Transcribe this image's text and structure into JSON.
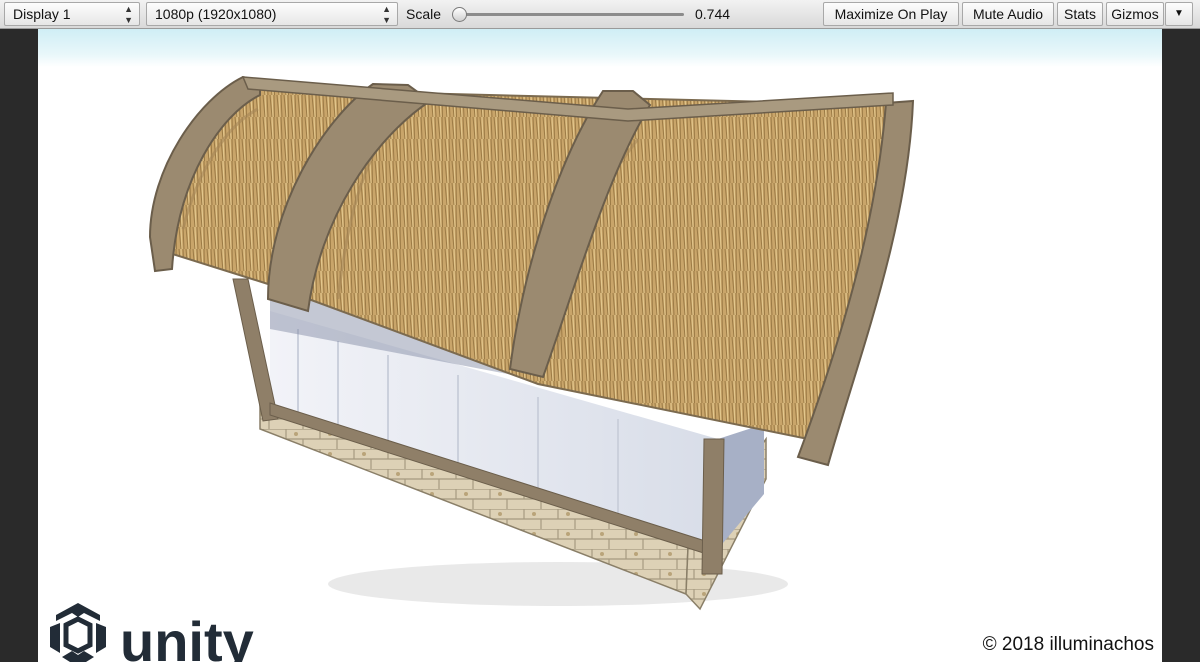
{
  "toolbar": {
    "display": "Display 1",
    "resolution": "1080p (1920x1080)",
    "scale_label": "Scale",
    "scale_value": "0.744",
    "scale_fraction": 0.0,
    "maximize_on_play": "Maximize On Play",
    "mute_audio": "Mute Audio",
    "stats": "Stats",
    "gizmos": "Gizmos"
  },
  "viewport": {
    "logo_text": "unity",
    "copyright": "© 2018 illuminachos"
  },
  "colors": {
    "toolbar_bg": "#dedede",
    "sky_top": "#cfeef5",
    "wood": "#8f7f68",
    "thatch": "#c9a56a",
    "plaster": "#e9edf5",
    "stone": "#d8cdb4"
  }
}
